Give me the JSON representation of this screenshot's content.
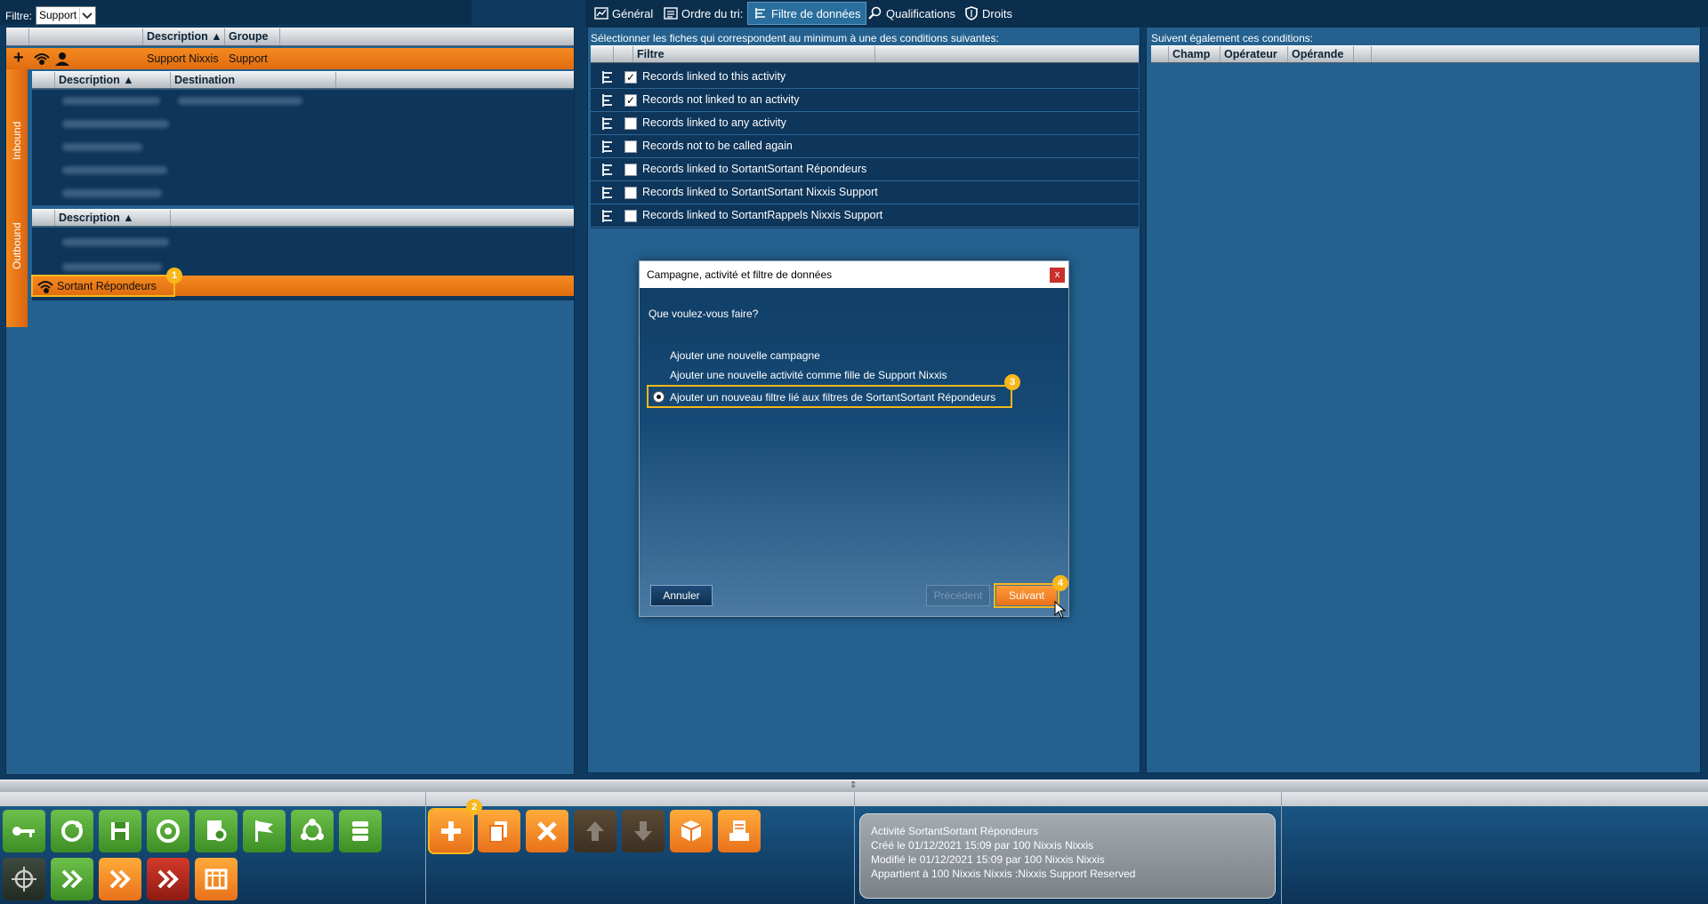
{
  "filter": {
    "label": "Filtre:",
    "value": "Support"
  },
  "left_grid": {
    "columns": [
      "Description",
      "Groupe"
    ],
    "campaign": {
      "name": "Support Nixxis",
      "group": "Support"
    },
    "inbound": {
      "label": "Inbound",
      "columns": [
        "Description",
        "Destination"
      ]
    },
    "outbound": {
      "label": "Outbound",
      "columns": [
        "Description"
      ],
      "selected": "Sortant Répondeurs"
    }
  },
  "tabs": [
    {
      "label": "Général"
    },
    {
      "label": "Ordre du tri:"
    },
    {
      "label": "Filtre de données"
    },
    {
      "label": "Qualifications"
    },
    {
      "label": "Droits"
    }
  ],
  "filter_panel": {
    "title": "Sélectionner les fiches qui correspondent au minimum à une des conditions suivantes:",
    "column": "Filtre",
    "rows": [
      {
        "label": "Records linked to this activity",
        "checked": true
      },
      {
        "label": "Records not linked to an activity",
        "checked": true
      },
      {
        "label": "Records linked to any activity",
        "checked": false
      },
      {
        "label": "Records not to be called again",
        "checked": false
      },
      {
        "label": "Records linked to SortantSortant Répondeurs",
        "checked": false
      },
      {
        "label": "Records linked to SortantSortant Nixxis Support",
        "checked": false
      },
      {
        "label": "Records linked to SortantRappels Nixxis Support",
        "checked": false
      }
    ]
  },
  "conditions_panel": {
    "title": "Suivent également ces conditions:",
    "columns": [
      "Champ",
      "Opérateur",
      "Opérande"
    ]
  },
  "dialog": {
    "title": "Campagne, activité et filtre de données",
    "close": "x",
    "question": "Que voulez-vous faire?",
    "options": [
      "Ajouter une nouvelle campagne",
      "Ajouter une nouvelle activité comme fille de Support Nixxis",
      "Ajouter un nouveau filtre lié aux filtres de SortantSortant Répondeurs"
    ],
    "selected_option": 2,
    "cancel": "Annuler",
    "previous": "Précédent",
    "next": "Suivant"
  },
  "badges": [
    "1",
    "2",
    "3",
    "4"
  ],
  "info": {
    "line1": "Activité SortantSortant Répondeurs",
    "line2": "Créé le 01/12/2021 15:09 par 100 Nixxis Nixxis",
    "line3": "Modifié le 01/12/2021 15:09 par 100 Nixxis Nixxis",
    "line4": "Appartient à 100 Nixxis Nixxis :Nixxis Support Reserved"
  },
  "colors": {
    "accent": "#e9711a",
    "highlight": "#f8b71a",
    "background": "#0f3a60"
  }
}
